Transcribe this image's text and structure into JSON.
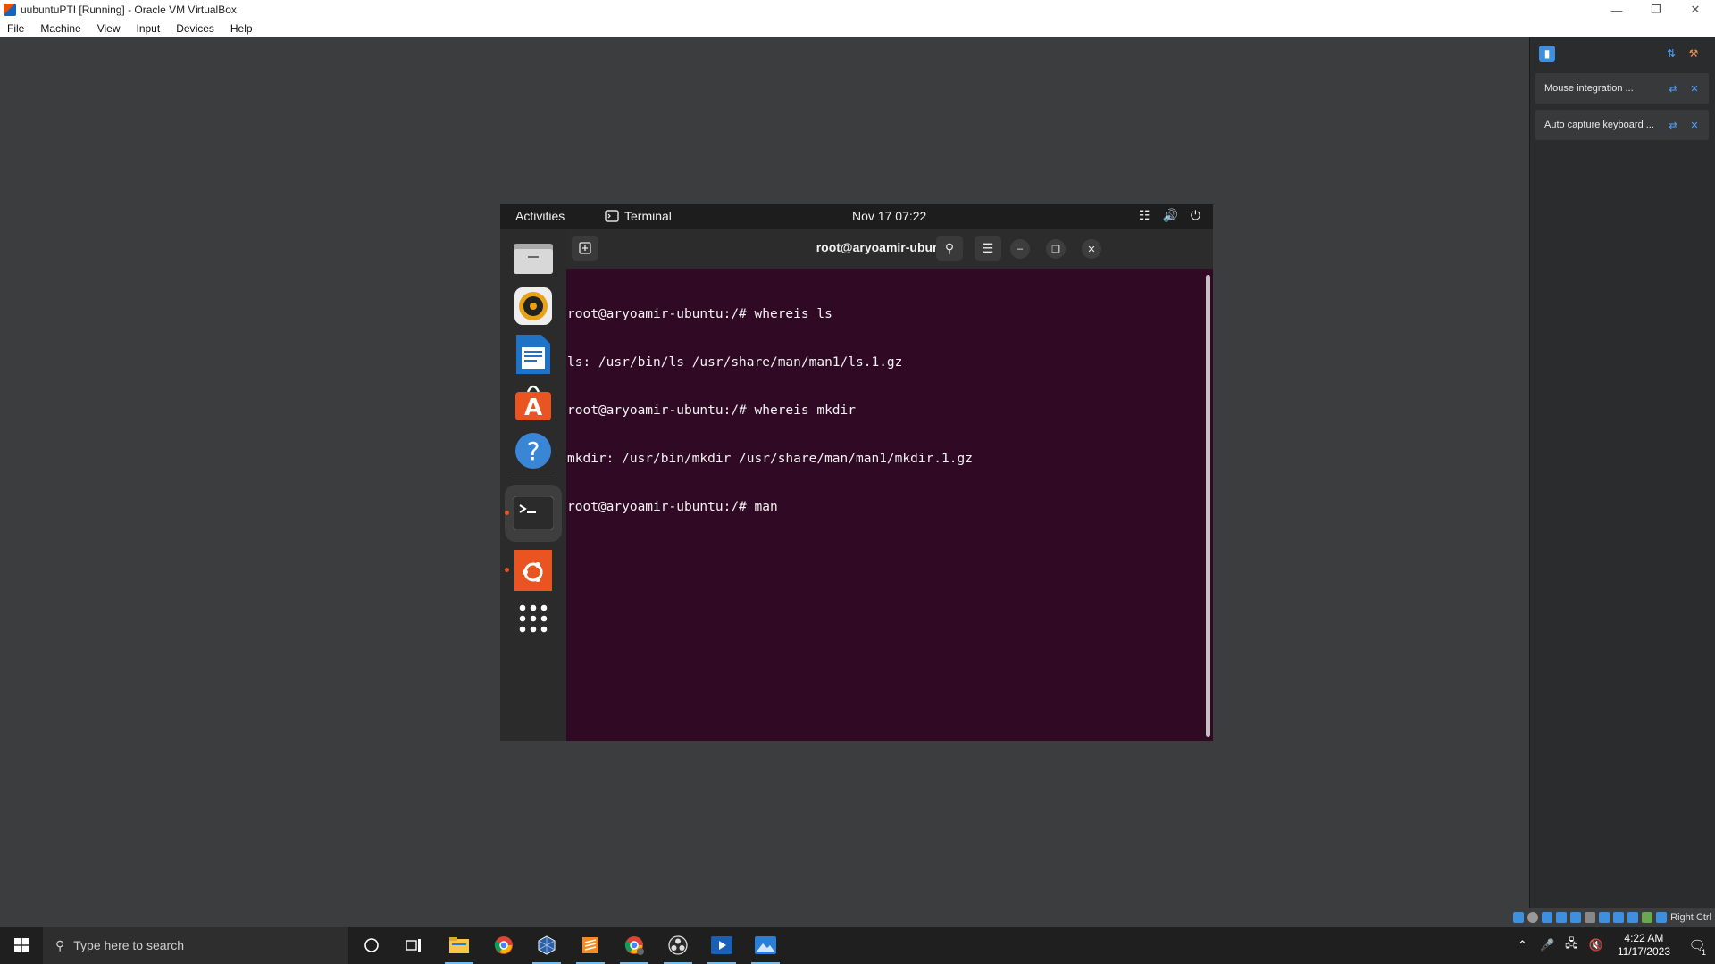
{
  "window": {
    "title": "uubuntuPTI [Running] - Oracle VM VirtualBox",
    "controls": [
      "minimize-icon",
      "restore-icon",
      "close-icon"
    ]
  },
  "menu": [
    "File",
    "Machine",
    "View",
    "Input",
    "Devices",
    "Help"
  ],
  "notifications": [
    {
      "text": "Mouse integration ..."
    },
    {
      "text": "Auto capture keyboard ..."
    }
  ],
  "status_bar": {
    "host_key": "Right Ctrl"
  },
  "guest": {
    "topbar": {
      "activities": "Activities",
      "app_name": "Terminal",
      "datetime": "Nov 17  07:22"
    },
    "dock": [
      {
        "name": "files-icon"
      },
      {
        "name": "rhythmbox-icon"
      },
      {
        "name": "libreoffice-writer-icon"
      },
      {
        "name": "software-center-icon"
      },
      {
        "name": "help-icon"
      },
      {
        "name": "terminal-icon",
        "running": true
      },
      {
        "name": "ubuntu-icon",
        "running": true
      },
      {
        "name": "show-apps-icon"
      }
    ],
    "terminal": {
      "title": "root@aryoamir-ubuntu: /",
      "lines": [
        "root@aryoamir-ubuntu:/# whereis ls",
        "ls: /usr/bin/ls /usr/share/man/man1/ls.1.gz",
        "root@aryoamir-ubuntu:/# whereis mkdir",
        "mkdir: /usr/bin/mkdir /usr/share/man/man1/mkdir.1.gz",
        "root@aryoamir-ubuntu:/# man"
      ]
    }
  },
  "taskbar": {
    "search_placeholder": "Type here to search",
    "time": "4:22 AM",
    "date": "11/17/2023",
    "notification_count": "1"
  },
  "colors": {
    "terminal_bg": "#300a24",
    "ubuntu_orange": "#e95420",
    "desktop_bg": "#3b3d3f"
  }
}
